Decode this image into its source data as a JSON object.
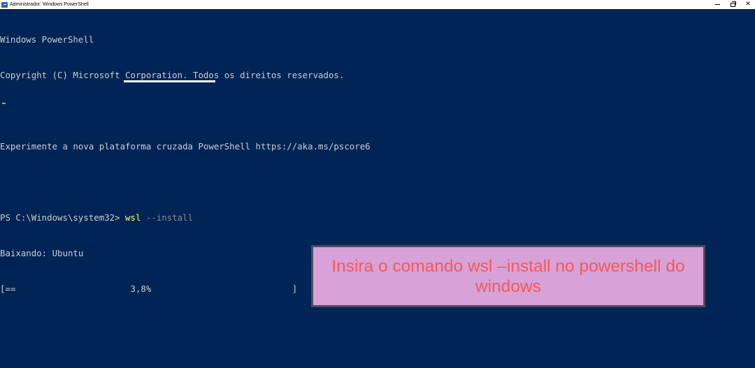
{
  "window": {
    "title": "Administrador: Windows PowerShell",
    "icon": "powershell-icon",
    "controls": {
      "minimize_icon": "minimize-icon",
      "maximize_icon": "restore-icon",
      "close_icon": "close-icon",
      "close_glyph": "✕"
    }
  },
  "terminal": {
    "lines": [
      "Windows PowerShell",
      "Copyright (C) Microsoft Corporation. Todos os direitos reservados.",
      "",
      "Experimente a nova plataforma cruzada PowerShell https://aka.ms/pscore6",
      ""
    ],
    "prompt": "PS C:\\Windows\\system32> ",
    "command_name": "wsl",
    "command_args": " --install",
    "download_status": "Baixando: Ubuntu",
    "progress": {
      "bar": "[==                      3,8%                           ]",
      "percent": 3.8
    }
  },
  "annotation": {
    "text": "Insira o comando wsl –install no powershell do windows"
  },
  "colors": {
    "background": "#012456",
    "text": "#cccccc",
    "command_name": "#ffff5c",
    "command_args": "#8a8a8a",
    "annotation_fill": "#d8a1d8",
    "annotation_text": "#f25a5a",
    "annotation_border": "#4a4b5c"
  }
}
